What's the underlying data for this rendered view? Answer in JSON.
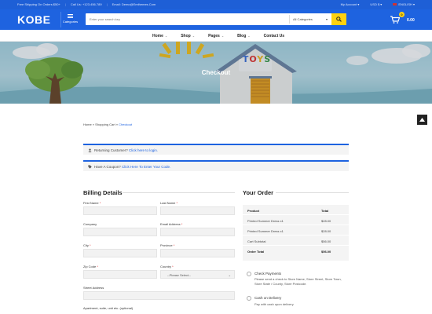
{
  "topbar": {
    "shipping": "Free Shipping On Orders $50+",
    "phone": "Call Us: +123.456.789",
    "email": "Email: Demo@Emthemes.Com",
    "account": "My Account",
    "currency": "USD $",
    "language": "ENGLISH"
  },
  "header": {
    "logo": "KOBE",
    "categories_label": "Categories",
    "search_placeholder": "Enter your search key",
    "search_category": "All Categories",
    "cart_count": "0",
    "cart_total": "0.00"
  },
  "nav": {
    "items": [
      {
        "label": "Home"
      },
      {
        "label": "Shop"
      },
      {
        "label": "Pages"
      },
      {
        "label": "Blog"
      },
      {
        "label": "Contact Us"
      }
    ]
  },
  "hero": {
    "title": "Checkout",
    "sign_text": "TOYS"
  },
  "breadcrumb": {
    "home": "Home",
    "cart": "Shopping Cart",
    "current": "Checkout",
    "sep": " » "
  },
  "notices": {
    "returning_text": "Returning Customer?",
    "returning_link": "Click here to login.",
    "coupon_text": "Have A Coupon?",
    "coupon_link": "Click Here To Enter Your Code."
  },
  "billing": {
    "title": "Billing Details",
    "first_name": "First Name",
    "last_name": "Last Name",
    "company": "Company",
    "email": "Email Address",
    "city": "City",
    "province": "Province",
    "zip": "Zip Code",
    "country": "Country",
    "country_value": "--Please Select--",
    "street": "Street Address",
    "apartment": "Apartment, suite, unit etc. (optional)",
    "required_mark": "*"
  },
  "order": {
    "title": "Your Order",
    "col_product": "Product",
    "col_total": "Total",
    "rows": [
      {
        "product": "Printed Summer Dress x1",
        "total": "$28.00"
      },
      {
        "product": "Printed Summer Dress x1",
        "total": "$28.00"
      }
    ],
    "subtotal_label": "Cart Subtotal",
    "subtotal": "$56.00",
    "total_label": "Order Total",
    "total": "$56.00"
  },
  "payment": {
    "check_label": "Check Payments",
    "check_desc": "Please send a check to Store Name, Store Street, Store Town, Store State / County, Store Postcode.",
    "cod_label": "Cash on Delivery",
    "cod_desc": "Pay with cash upon delivery."
  },
  "colors": {
    "brand_blue": "#1e63e0",
    "accent_yellow": "#ffd20f"
  }
}
